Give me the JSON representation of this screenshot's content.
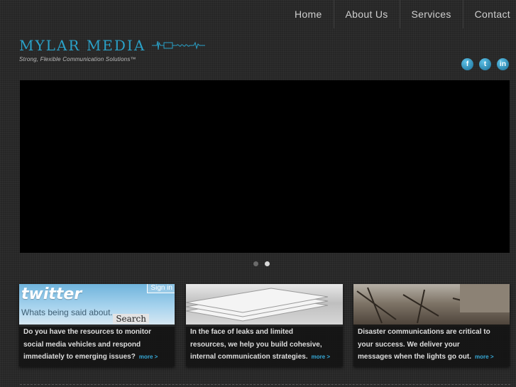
{
  "nav": {
    "items": [
      {
        "label": "Home"
      },
      {
        "label": "About Us"
      },
      {
        "label": "Services"
      },
      {
        "label": "Contact"
      }
    ]
  },
  "brand": {
    "name": "MYLAR MEDIA",
    "tagline": "Strong, Flexible Communication Solutions™",
    "accent_color": "#2aa1c8"
  },
  "social": [
    {
      "icon": "facebook-icon",
      "glyph": "f"
    },
    {
      "icon": "twitter-icon",
      "glyph": "t"
    },
    {
      "icon": "linkedin-icon",
      "glyph": "in"
    }
  ],
  "slider": {
    "slide_count": 2,
    "active_index": 1
  },
  "cards": [
    {
      "image": {
        "headline": "twitter",
        "caption": "Whats being said about...",
        "search": "Search",
        "signin": "Sign in"
      },
      "lines": [
        "Do you have the resources to monitor",
        "social media vehicles and respond",
        "immediately to emerging issues?"
      ],
      "more": "more >"
    },
    {
      "lines": [
        "In the face of leaks and limited",
        "resources, we help you build cohesive,",
        "internal communication strategies."
      ],
      "more": "more >"
    },
    {
      "lines": [
        "Disaster communications are critical to",
        "your success. We deliver your",
        "messages when the lights go out."
      ],
      "more": "more >"
    }
  ]
}
